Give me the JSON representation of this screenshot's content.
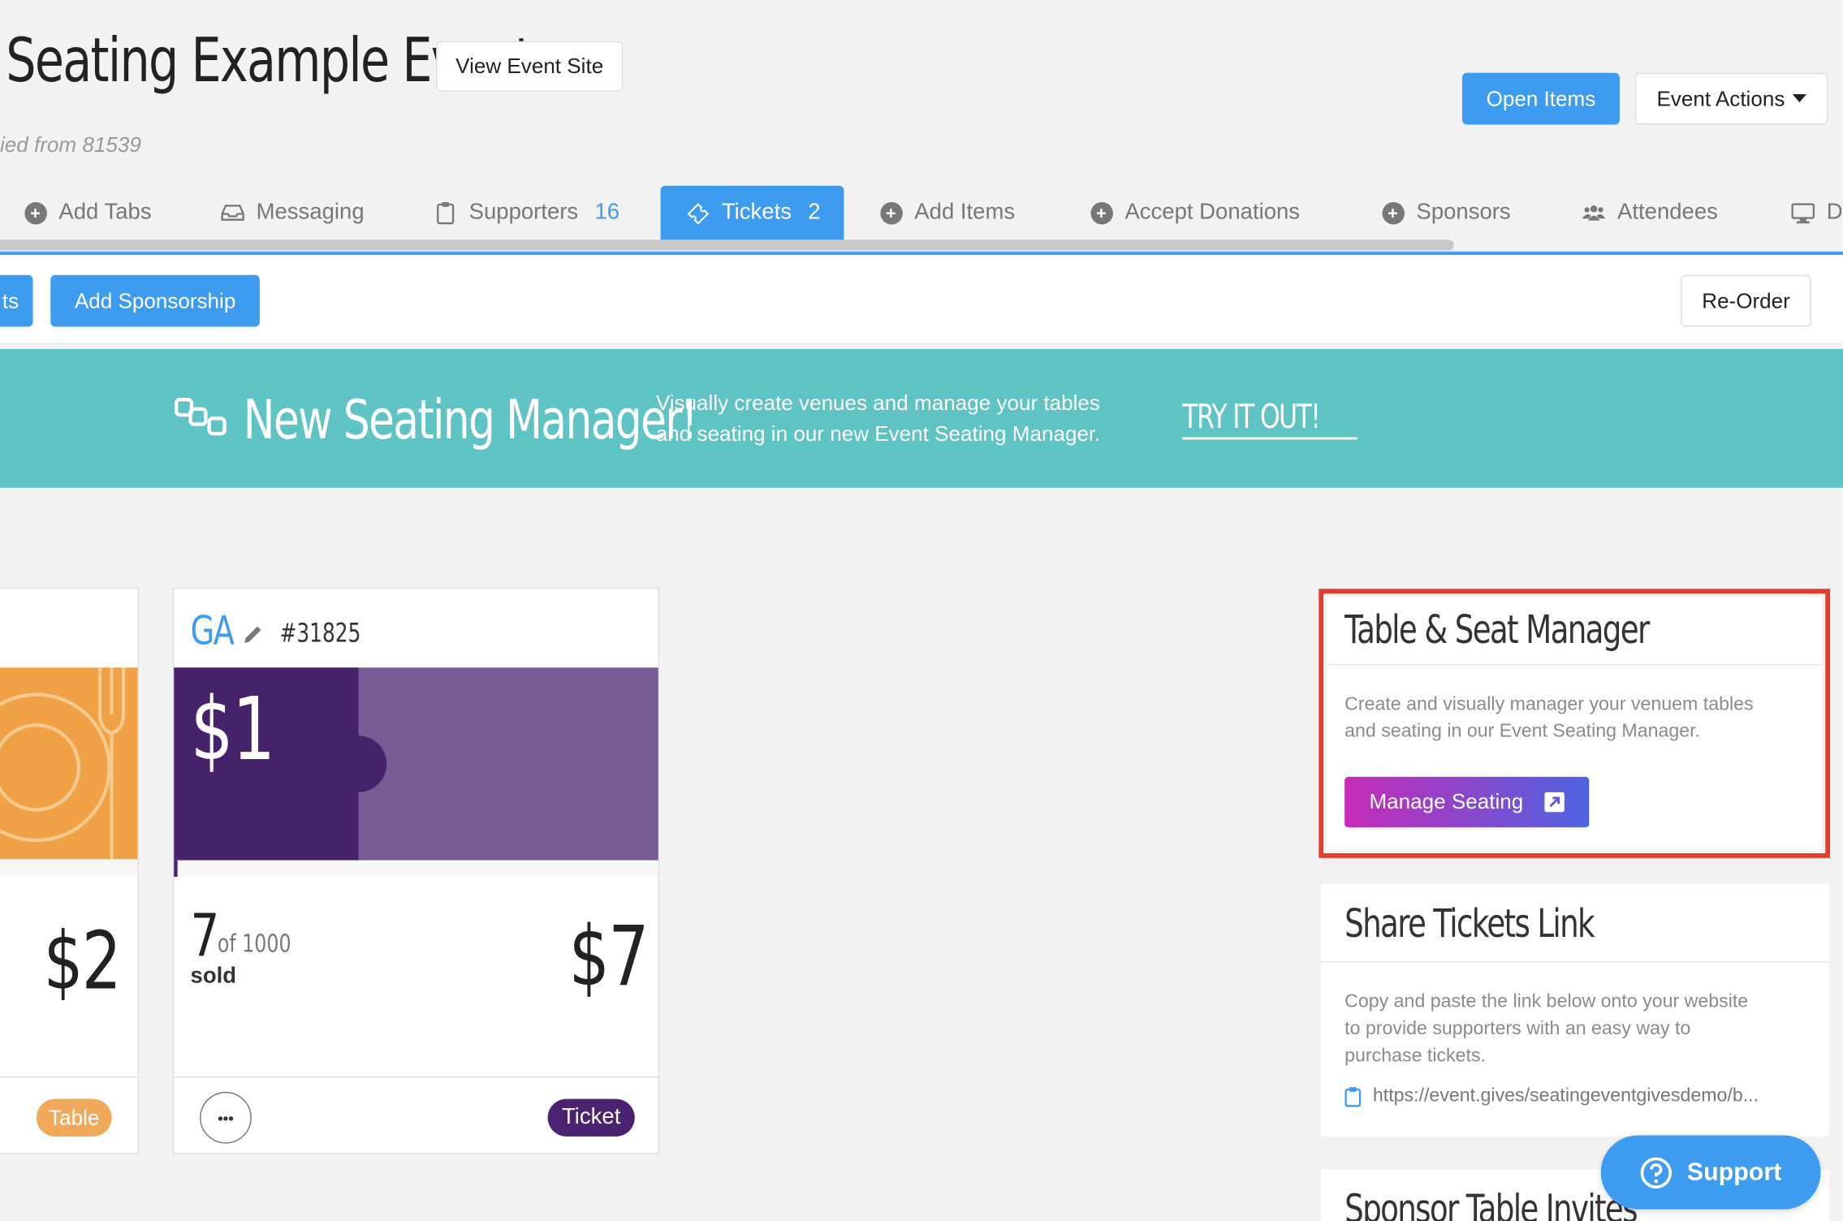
{
  "header": {
    "title": "Seating Example Event",
    "view_site_label": "View Event Site",
    "copied_from": "ied from 81539",
    "open_items_label": "Open Items",
    "event_actions_label": "Event Actions"
  },
  "tabs": [
    {
      "label": "Add Tabs",
      "icon": "plus-circle-icon"
    },
    {
      "label": "Messaging",
      "icon": "inbox-icon"
    },
    {
      "label": "Supporters",
      "count": "16",
      "icon": "clipboard-icon"
    },
    {
      "label": "Tickets",
      "count": "2",
      "icon": "ticket-icon",
      "active": true
    },
    {
      "label": "Add Items",
      "icon": "plus-circle-icon"
    },
    {
      "label": "Accept Donations",
      "icon": "plus-circle-icon"
    },
    {
      "label": "Sponsors",
      "icon": "plus-circle-icon"
    },
    {
      "label": "Attendees",
      "icon": "users-icon"
    },
    {
      "label": "D",
      "icon": "monitor-icon"
    }
  ],
  "toolbar": {
    "partial_button_label": "ts",
    "add_sponsorship_label": "Add Sponsorship",
    "reorder_label": "Re-Order"
  },
  "banner": {
    "title": "New Seating Manager!",
    "text_line1": "Visually create venues and manage your tables",
    "text_line2": "and seating in our new Event Seating Manager.",
    "cta": "TRY IT OUT!",
    "color": "#5fc3c4"
  },
  "cards": {
    "table_card": {
      "price": "$2",
      "badge": "Table",
      "badge_color": "#f0a95a",
      "accent_color": "#f0a045"
    },
    "ga_card": {
      "name": "GA",
      "id": "#31825",
      "ticket_price": "$1",
      "sold_count": "7",
      "sold_of": "of 1000",
      "sold_label": "sold",
      "total": "$7",
      "menu_label": "•••",
      "badge": "Ticket",
      "badge_color": "#4a2270",
      "dark_color": "#46226b",
      "light_color": "#765b94"
    }
  },
  "seat_manager": {
    "title": "Table & Seat Manager",
    "desc_line1": "Create and visually manager your venuem tables",
    "desc_line2": "and seating in our Event Seating Manager.",
    "button_label": "Manage Seating",
    "highlight_color": "#e53b2a"
  },
  "share_link": {
    "title": "Share Tickets Link",
    "desc_line1": "Copy and paste the link below onto your website",
    "desc_line2": "to provide supporters with an easy way to",
    "desc_line3": "purchase tickets.",
    "url": "https://event.gives/seatingeventgivesdemo/b..."
  },
  "sponsor_invites": {
    "title": "Sponsor Table Invites"
  },
  "support": {
    "label": "Support"
  }
}
